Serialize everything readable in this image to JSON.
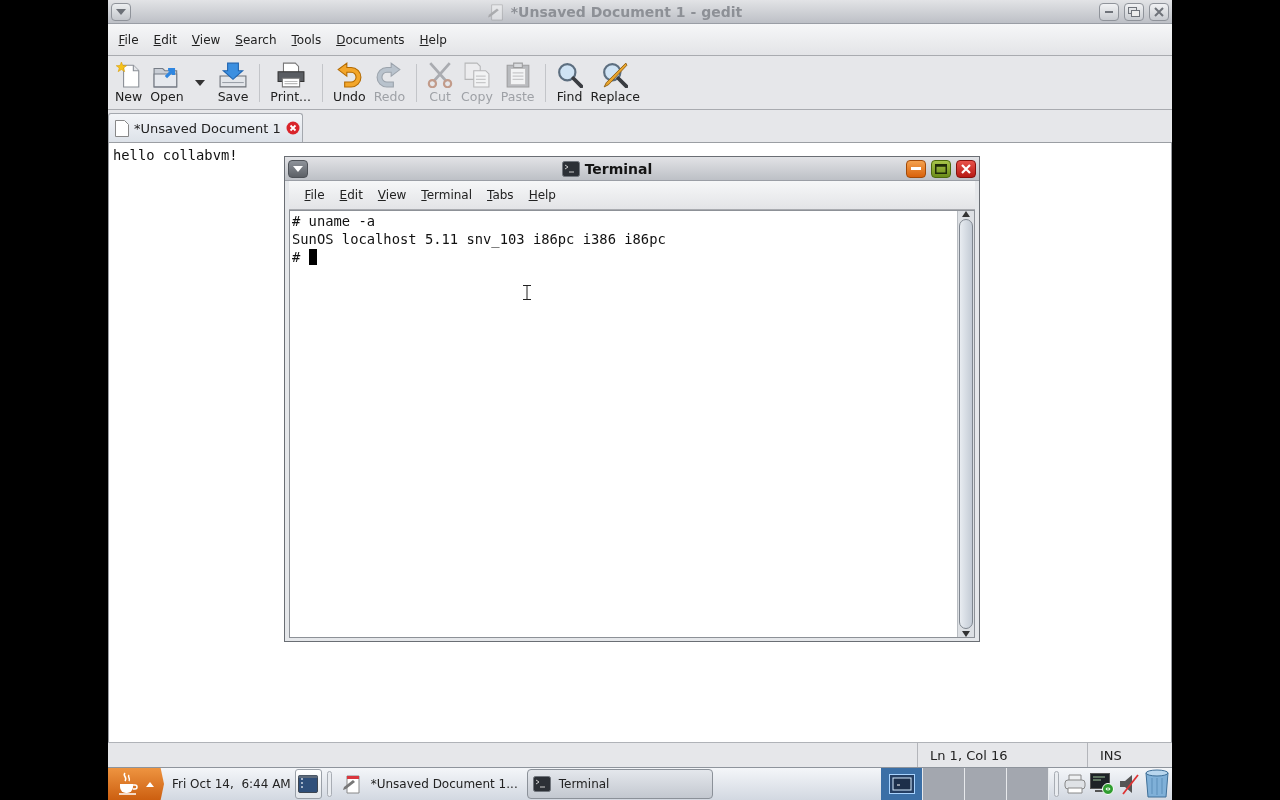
{
  "gedit_window": {
    "title": "*Unsaved Document 1 - gedit",
    "active": false,
    "menu": [
      "File",
      "Edit",
      "View",
      "Search",
      "Tools",
      "Documents",
      "Help"
    ],
    "toolbar": [
      {
        "buttons": [
          {
            "label": "New",
            "disabled": false,
            "has_menu": false
          },
          {
            "label": "Open",
            "disabled": false,
            "has_menu": true
          },
          {
            "label": "Save",
            "disabled": false,
            "has_menu": false
          }
        ]
      },
      {
        "buttons": [
          {
            "label": "Print...",
            "disabled": false,
            "has_menu": false
          }
        ]
      },
      {
        "buttons": [
          {
            "label": "Undo",
            "disabled": false,
            "has_menu": false
          },
          {
            "label": "Redo",
            "disabled": true,
            "has_menu": false
          }
        ]
      },
      {
        "buttons": [
          {
            "label": "Cut",
            "disabled": true,
            "has_menu": false
          },
          {
            "label": "Copy",
            "disabled": true,
            "has_menu": false
          },
          {
            "label": "Paste",
            "disabled": true,
            "has_menu": false
          }
        ]
      },
      {
        "buttons": [
          {
            "label": "Find",
            "disabled": false,
            "has_menu": false
          },
          {
            "label": "Replace",
            "disabled": false,
            "has_menu": false
          }
        ]
      }
    ],
    "tabs": [
      {
        "label": "*Unsaved Document 1",
        "selected": true
      }
    ],
    "editor_text": "hello collabvm!",
    "status_bar": {
      "position": "Ln 1, Col 16",
      "mode": "INS"
    }
  },
  "terminal_window": {
    "title": "Terminal",
    "active": true,
    "menu": [
      "File",
      "Edit",
      "View",
      "Terminal",
      "Tabs",
      "Help"
    ],
    "lines": [
      "# uname -a",
      "SunOS localhost 5.11 snv_103 i86pc i386 i86pc",
      "# "
    ]
  },
  "taskbar": {
    "clock": "Fri Oct 14,  6:44 AM",
    "tasks": [
      {
        "label": "*Unsaved Document 1...",
        "selected": false
      },
      {
        "label": "Terminal",
        "selected": true
      }
    ],
    "workspaces": [
      {
        "selected": true
      },
      {
        "selected": false
      },
      {
        "selected": false
      },
      {
        "selected": false
      }
    ]
  }
}
